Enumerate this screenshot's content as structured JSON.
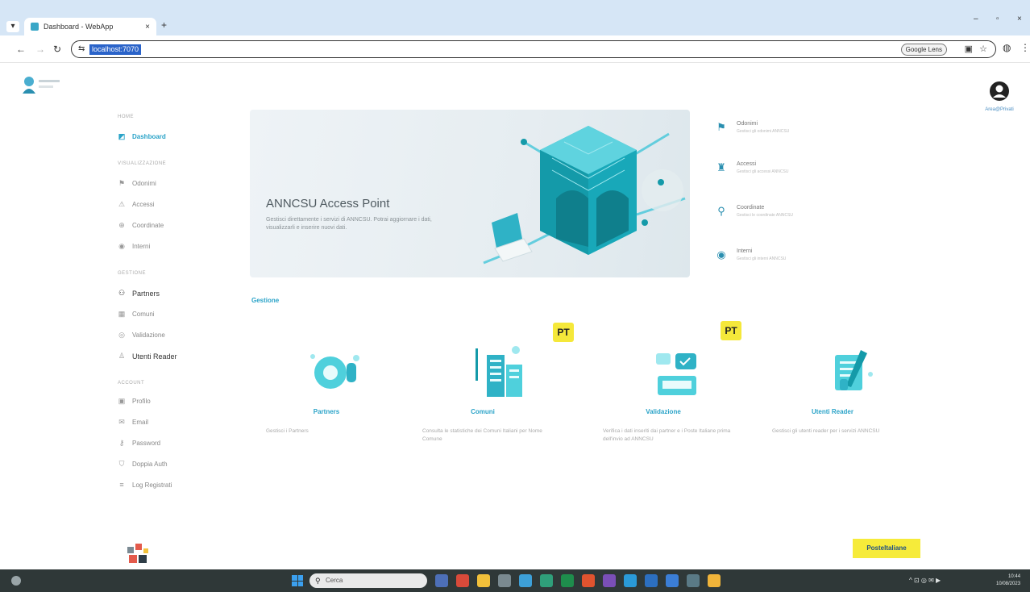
{
  "browser": {
    "tab_title": "Dashboard - WebApp",
    "tab_close": "×",
    "new_tab": "+",
    "window_min": "–",
    "window_max": "▫",
    "window_close": "×",
    "back": "←",
    "forward": "→",
    "reload": "↻",
    "url": "localhost:7070",
    "lens_label": "Google Lens",
    "omni_icons": [
      "translate-icon",
      "star-icon"
    ]
  },
  "header": {
    "user_name": "Area@Privati"
  },
  "sidebar": {
    "sections": [
      {
        "label": "HOME"
      },
      {
        "label": "VISUALIZZAZIONE"
      },
      {
        "label": "GESTIONE"
      },
      {
        "label": "ACCOUNT"
      }
    ],
    "items": [
      {
        "label": "Dashboard",
        "icon": "dashboard-icon",
        "glyph": "◩"
      },
      {
        "label": "Odonimi",
        "icon": "flag-icon",
        "glyph": "⚑"
      },
      {
        "label": "Accessi",
        "icon": "access-icon",
        "glyph": "⚠"
      },
      {
        "label": "Coordinate",
        "icon": "pin-icon",
        "glyph": "⊕"
      },
      {
        "label": "Interni",
        "icon": "location-icon",
        "glyph": "◉"
      },
      {
        "label": "Partners",
        "icon": "partners-icon",
        "glyph": "⚇"
      },
      {
        "label": "Comuni",
        "icon": "building-icon",
        "glyph": "▦"
      },
      {
        "label": "Validazione",
        "icon": "check-circle-icon",
        "glyph": "◎"
      },
      {
        "label": "Utenti Reader",
        "icon": "user-icon",
        "glyph": "♙"
      },
      {
        "label": "Profilo",
        "icon": "profile-icon",
        "glyph": "▣"
      },
      {
        "label": "Email",
        "icon": "email-icon",
        "glyph": "✉"
      },
      {
        "label": "Password",
        "icon": "key-icon",
        "glyph": "⚷"
      },
      {
        "label": "Doppia Auth",
        "icon": "shield-icon",
        "glyph": "⛉"
      },
      {
        "label": "Log Registrati",
        "icon": "log-icon",
        "glyph": "≡"
      }
    ]
  },
  "hero": {
    "title": "ANNCSU Access Point",
    "description": "Gestisci direttamente i servizi di ANNCSU. Potrai aggiornare i dati, visualizzarli e inserire nuovi dati."
  },
  "quick_links": [
    {
      "title": "Odonimi",
      "subtitle": "Gestisci gli odonimi ANNCSU",
      "icon": "flag-icon",
      "glyph": "⚑"
    },
    {
      "title": "Accessi",
      "subtitle": "Gestisci gli accessi ANNCSU",
      "icon": "access-icon",
      "glyph": "♜"
    },
    {
      "title": "Coordinate",
      "subtitle": "Gestisci le coordinate ANNCSU",
      "icon": "pin-icon",
      "glyph": "⚲"
    },
    {
      "title": "Interni",
      "subtitle": "Gestisci gli interni ANNCSU",
      "icon": "location-icon",
      "glyph": "◉"
    }
  ],
  "gestione": {
    "title": "Gestione",
    "cards": [
      {
        "title": "Partners",
        "description": "Gestisci i Partners",
        "icon": "gear-bulb-icon",
        "badge": ""
      },
      {
        "title": "Comuni",
        "description": "Consulta le statistiche dei Comuni Italiani per Nome Comune",
        "icon": "buildings-icon",
        "badge": "PT"
      },
      {
        "title": "Validazione",
        "description": "Verifica i dati inseriti dai partner e i Poste Italiane prima dell'invio ad ANNCSU",
        "icon": "validation-icon",
        "badge": "PT"
      },
      {
        "title": "Utenti Reader",
        "description": "Gestisci gli utenti reader per i servizi ANNCSU",
        "icon": "document-pen-icon",
        "badge": ""
      }
    ]
  },
  "footer": {
    "poste_button": "PosteItaliane"
  },
  "taskbar": {
    "search_placeholder": "Cerca",
    "search_icon": "search-icon",
    "tray_text": "^  ⊡  ◎ ✉ ▶",
    "time": "10:44",
    "date": "10/08/2023"
  },
  "colors": {
    "accent": "#2aa3c8",
    "poste_yellow": "#f6eb3a",
    "taskbar": "#2f3838",
    "tabbar": "#d6e6f6"
  }
}
